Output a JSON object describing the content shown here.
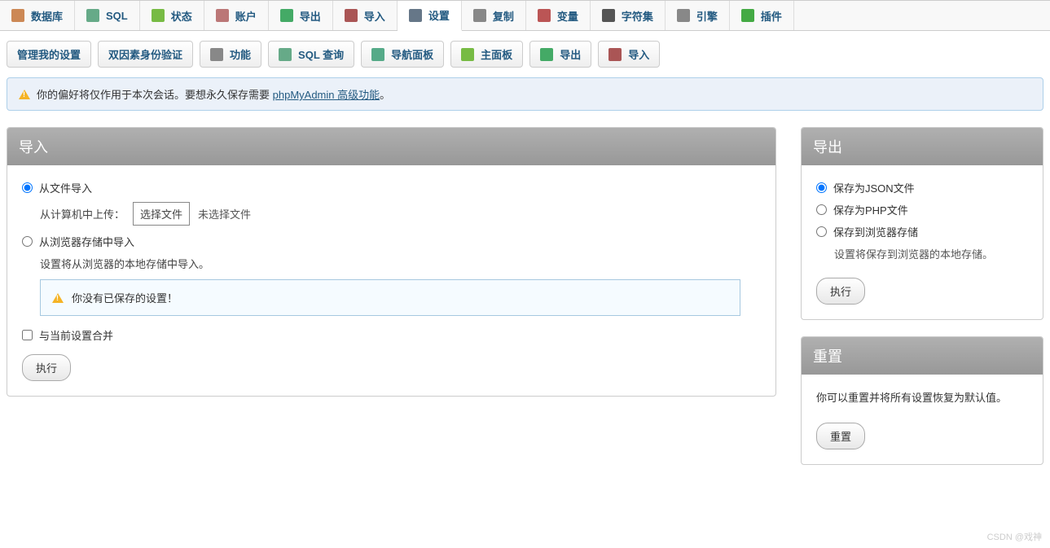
{
  "topnav": [
    {
      "label": "数据库",
      "icon": "#c85"
    },
    {
      "label": "SQL",
      "icon": "#6a8"
    },
    {
      "label": "状态",
      "icon": "#7b4"
    },
    {
      "label": "账户",
      "icon": "#b77"
    },
    {
      "label": "导出",
      "icon": "#4a6"
    },
    {
      "label": "导入",
      "icon": "#a55"
    },
    {
      "label": "设置",
      "icon": "#678",
      "active": true
    },
    {
      "label": "复制",
      "icon": "#888"
    },
    {
      "label": "变量",
      "icon": "#b55"
    },
    {
      "label": "字符集",
      "icon": "#555"
    },
    {
      "label": "引擎",
      "icon": "#888"
    },
    {
      "label": "插件",
      "icon": "#4a4"
    }
  ],
  "subnav": [
    {
      "label": "管理我的设置",
      "icon": null
    },
    {
      "label": "双因素身份验证",
      "icon": null
    },
    {
      "label": "功能",
      "icon": "#888"
    },
    {
      "label": "SQL 查询",
      "icon": "#6a8"
    },
    {
      "label": "导航面板",
      "icon": "#5a8"
    },
    {
      "label": "主面板",
      "icon": "#7b4"
    },
    {
      "label": "导出",
      "icon": "#4a6"
    },
    {
      "label": "导入",
      "icon": "#a55"
    }
  ],
  "notice": {
    "text1": "你的偏好将仅作用于本次会话。要想永久保存需要 ",
    "link": "phpMyAdmin 高级功能",
    "text2": "。"
  },
  "import_panel": {
    "title": "导入",
    "opt_file": "从文件导入",
    "upload_label": "从计算机中上传：",
    "choose_file": "选择文件",
    "no_file": "未选择文件",
    "opt_browser": "从浏览器存储中导入",
    "browser_desc": "设置将从浏览器的本地存储中导入。",
    "no_saved": "你没有已保存的设置！",
    "merge": "与当前设置合并",
    "go": "执行"
  },
  "export_panel": {
    "title": "导出",
    "opt_json": "保存为JSON文件",
    "opt_php": "保存为PHP文件",
    "opt_browser": "保存到浏览器存储",
    "browser_desc": "设置将保存到浏览器的本地存储。",
    "go": "执行"
  },
  "reset_panel": {
    "title": "重置",
    "desc": "你可以重置并将所有设置恢复为默认值。",
    "go": "重置"
  },
  "watermark": "CSDN @戏神"
}
